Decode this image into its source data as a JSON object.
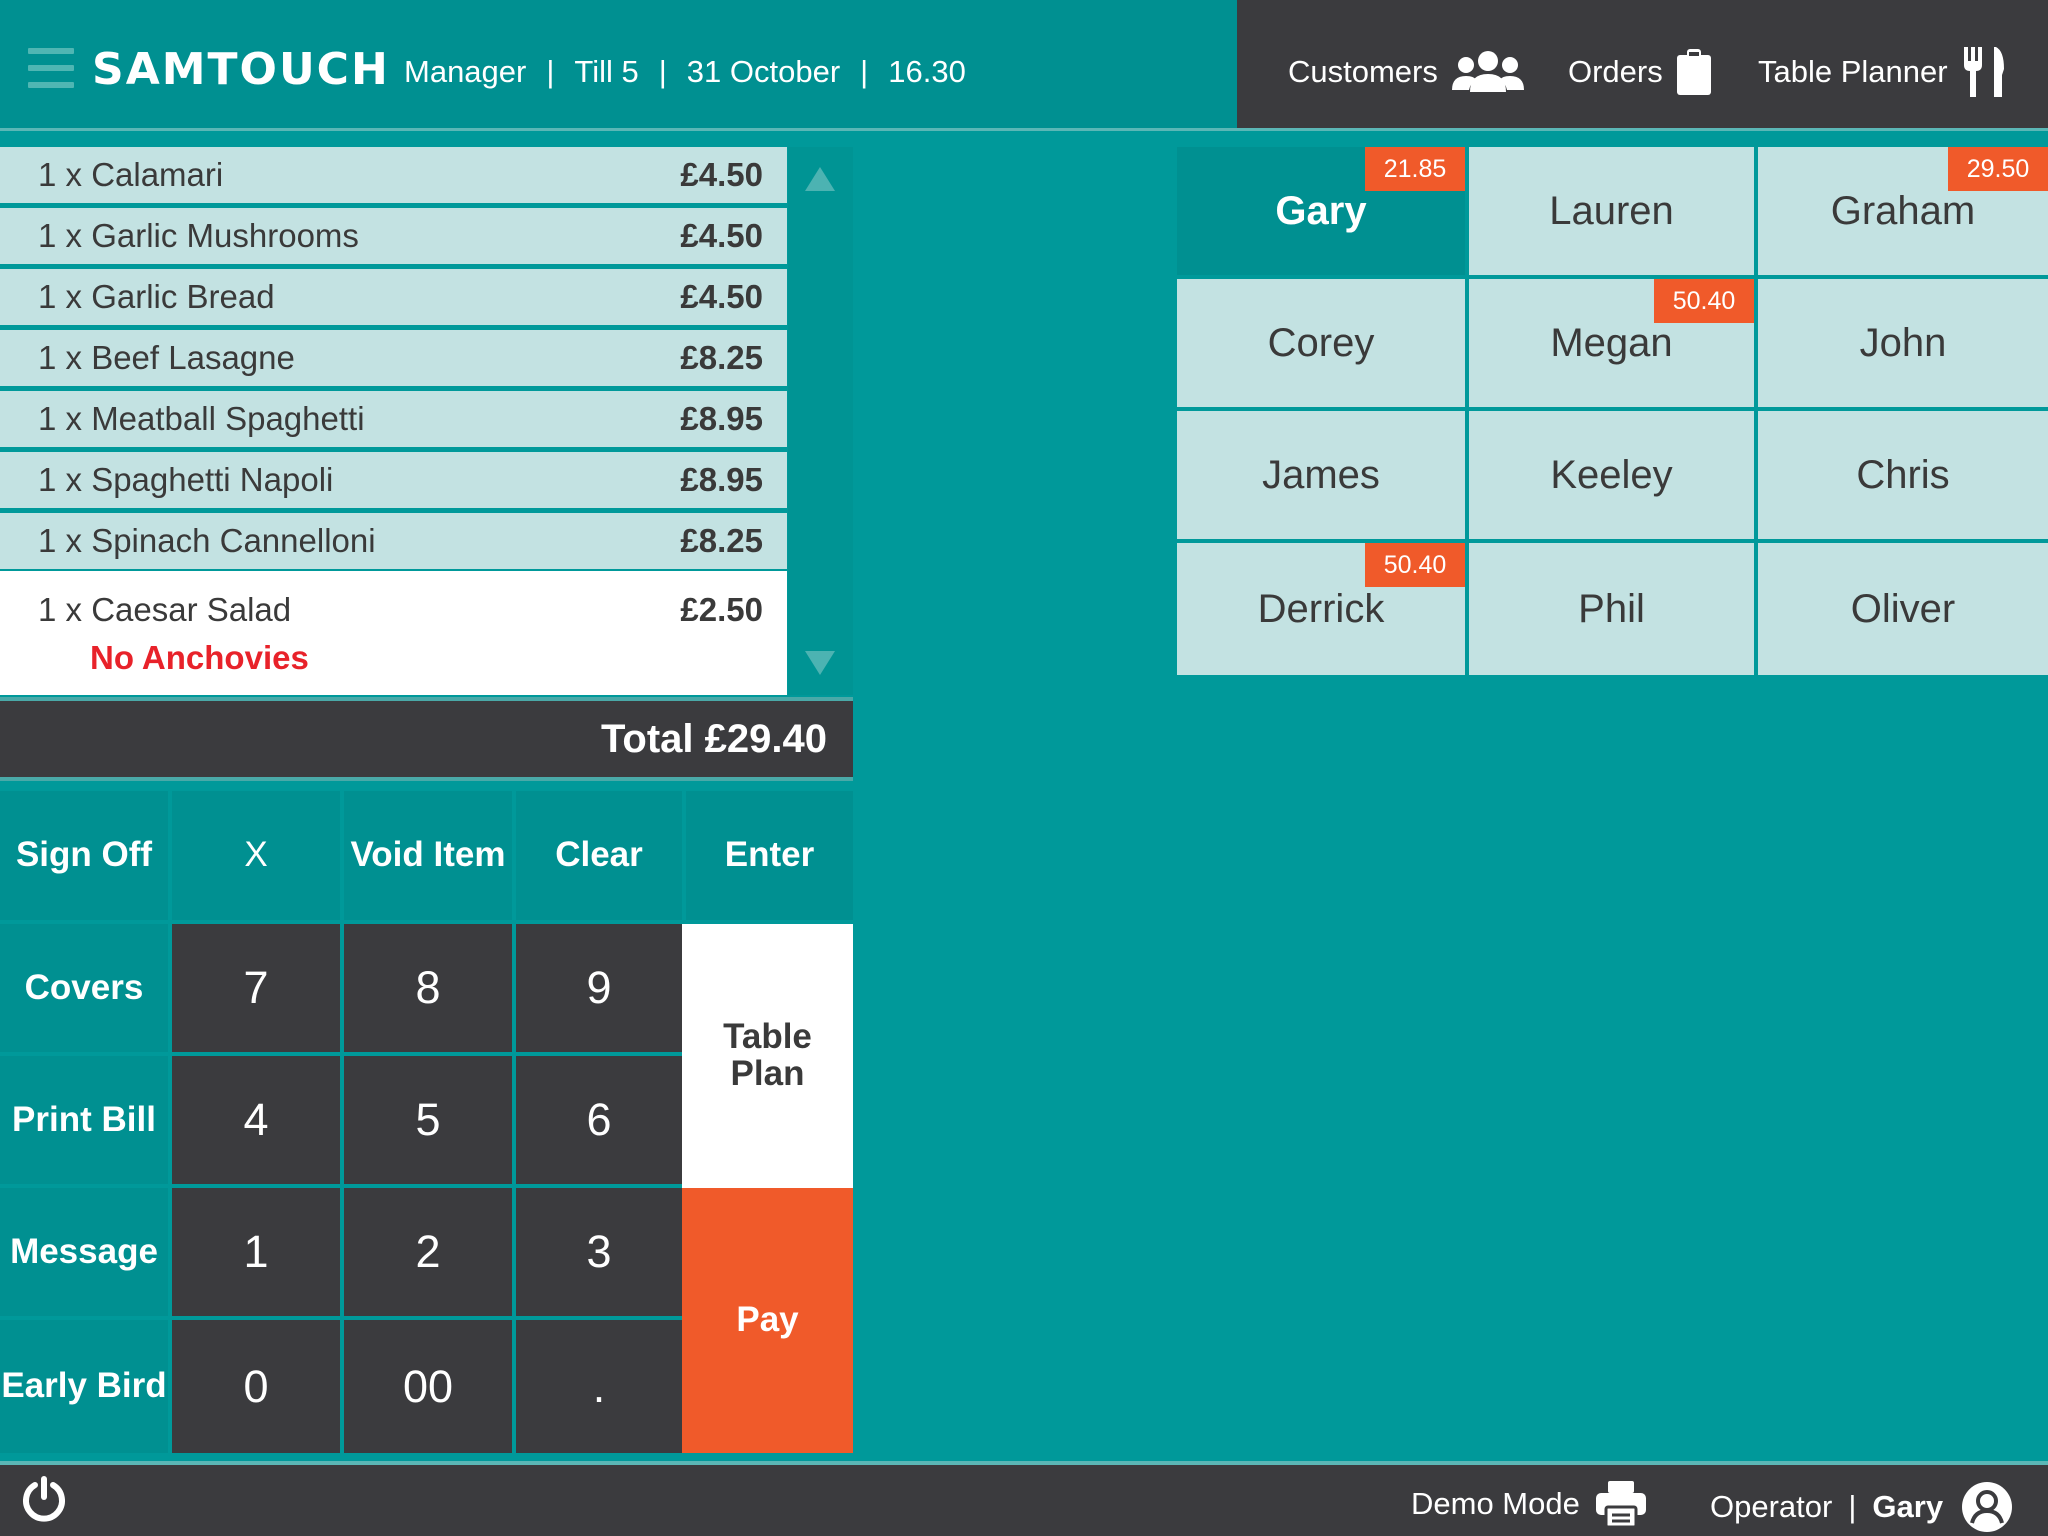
{
  "header": {
    "brand": "SAMTOUCH",
    "role": "Manager",
    "till": "Till 5",
    "date": "31 October",
    "time": "16.30",
    "separator": "|",
    "nav": {
      "customers": "Customers",
      "orders": "Orders",
      "table_planner": "Table Planner"
    }
  },
  "order": {
    "items": [
      {
        "name": "1 x Calamari",
        "price": "£4.50"
      },
      {
        "name": "1 x Garlic Mushrooms",
        "price": "£4.50"
      },
      {
        "name": "1 x Garlic Bread",
        "price": "£4.50"
      },
      {
        "name": "1 x Beef Lasagne",
        "price": "£8.25"
      },
      {
        "name": "1 x Meatball Spaghetti",
        "price": "£8.95"
      },
      {
        "name": "1 x Spaghetti Napoli",
        "price": "£8.95"
      },
      {
        "name": "1 x Spinach Cannelloni",
        "price": "£8.25"
      },
      {
        "name": "1 x Caesar Salad",
        "price": "£2.50",
        "note": "No Anchovies"
      }
    ],
    "total": "Total £29.40"
  },
  "keypad": {
    "sign_off": "Sign Off",
    "x": "X",
    "void_item": "Void Item",
    "clear": "Clear",
    "enter": "Enter",
    "covers": "Covers",
    "print_bill": "Print Bill",
    "message": "Message",
    "early_bird": "Early Bird",
    "table_plan": "Table Plan",
    "pay": "Pay",
    "digits": [
      "7",
      "8",
      "9",
      "4",
      "5",
      "6",
      "1",
      "2",
      "3",
      "0",
      "00",
      "."
    ]
  },
  "customers": [
    {
      "name": "Gary",
      "badge": "21.85",
      "active": true
    },
    {
      "name": "Lauren",
      "badge": ""
    },
    {
      "name": "Graham",
      "badge": "29.50"
    },
    {
      "name": "Corey",
      "badge": ""
    },
    {
      "name": "Megan",
      "badge": "50.40"
    },
    {
      "name": "John",
      "badge": ""
    },
    {
      "name": "James",
      "badge": ""
    },
    {
      "name": "Keeley",
      "badge": ""
    },
    {
      "name": "Chris",
      "badge": ""
    },
    {
      "name": "Derrick",
      "badge": "50.40"
    },
    {
      "name": "Phil",
      "badge": ""
    },
    {
      "name": "Oliver",
      "badge": ""
    }
  ],
  "footer": {
    "demo_mode": "Demo Mode",
    "operator_label": "Operator",
    "separator": "|",
    "operator_name": "Gary"
  },
  "colors": {
    "teal_background": "#00999a",
    "teal_dark": "#009091",
    "charcoal": "#3b3b3e",
    "row_light": "#c3e2e2",
    "badge_orange": "#f05a2a",
    "note_red": "#e8222a"
  },
  "icons": {
    "menu": "menu-icon",
    "customers": "customers-icon",
    "orders": "clipboard-icon",
    "table_planner": "cutlery-icon",
    "power": "power-icon",
    "printer": "printer-icon",
    "operator": "user-icon",
    "scroll_up": "arrow-up-icon",
    "scroll_down": "arrow-down-icon"
  }
}
